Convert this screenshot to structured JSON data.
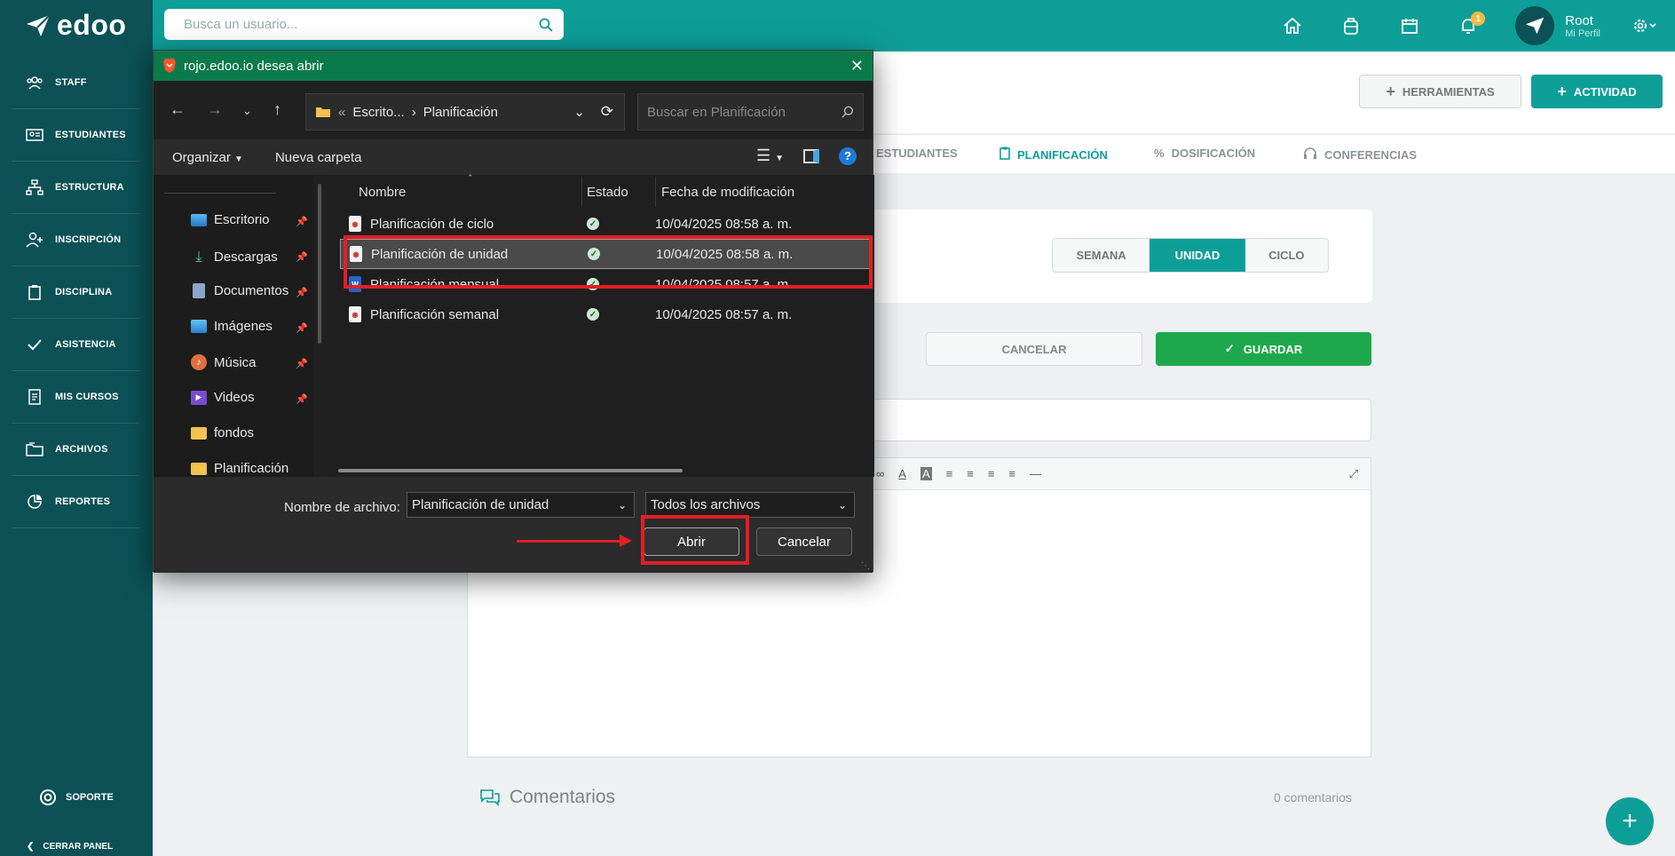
{
  "app": {
    "logo": "edoo"
  },
  "topbar": {
    "search_placeholder": "Busca un usuario...",
    "notifications_count": "1",
    "user_name": "Root",
    "user_sub": "Mi Perfil"
  },
  "sidebar": {
    "items": [
      {
        "label": "STAFF",
        "icon": "staff-icon"
      },
      {
        "label": "ESTUDIANTES",
        "icon": "students-icon"
      },
      {
        "label": "ESTRUCTURA",
        "icon": "structure-icon"
      },
      {
        "label": "INSCRIPCIÓN",
        "icon": "enroll-icon"
      },
      {
        "label": "DISCIPLINA",
        "icon": "clipboard-icon"
      },
      {
        "label": "ASISTENCIA",
        "icon": "check-icon"
      },
      {
        "label": "MIS CURSOS",
        "icon": "courses-icon"
      },
      {
        "label": "ARCHIVOS",
        "icon": "files-icon"
      },
      {
        "label": "REPORTES",
        "icon": "reports-icon"
      }
    ],
    "support": "SOPORTE",
    "collapse": "CERRAR PANEL"
  },
  "main": {
    "tools_button": "HERRAMIENTAS",
    "activity_button": "ACTIVIDAD",
    "tabs": [
      "ESTUDIANTES",
      "PLANIFICACIÓN",
      "DOSIFICACIÓN",
      "CONFERENCIAS"
    ],
    "segment": [
      "SEMANA",
      "UNIDAD",
      "CICLO"
    ],
    "cancel_button": "CANCELAR",
    "save_button": "GUARDAR",
    "comments_title": "Comentarios",
    "comments_count": "0 comentarios"
  },
  "dialog": {
    "title": "rojo.edoo.io desea abrir",
    "path_parent": "Escrito...",
    "path_current": "Planificación",
    "search_placeholder": "Buscar en Planificación",
    "organize": "Organizar",
    "new_folder": "Nueva carpeta",
    "nav_items": [
      "Escritorio",
      "Descargas",
      "Documentos",
      "Imágenes",
      "Música",
      "Videos",
      "fondos",
      "Planificación"
    ],
    "columns": {
      "name": "Nombre",
      "state": "Estado",
      "date": "Fecha de modificación"
    },
    "files": [
      {
        "name": "Planificación de ciclo",
        "date": "10/04/2025 08:58 a. m.",
        "type": "pdf"
      },
      {
        "name": "Planificación de unidad",
        "date": "10/04/2025 08:58 a. m.",
        "type": "pdf"
      },
      {
        "name": "Planificación mensual",
        "date": "10/04/2025 08:57 a. m.",
        "type": "word"
      },
      {
        "name": "Planificación semanal",
        "date": "10/04/2025 08:57 a. m.",
        "type": "pdf"
      }
    ],
    "filename_label": "Nombre de archivo:",
    "filename_value": "Planificación de unidad",
    "filetype_value": "Todos los archivos",
    "open_button": "Abrir",
    "cancel_button": "Cancelar"
  },
  "colors": {
    "teal": "#0e9e98",
    "sidebar": "#0b5156",
    "green": "#1ea84c",
    "highlight": "#e31e24"
  }
}
